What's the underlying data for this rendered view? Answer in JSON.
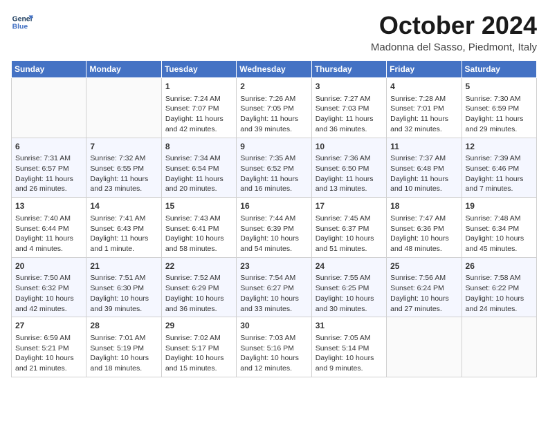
{
  "header": {
    "logo_line1": "General",
    "logo_line2": "Blue",
    "month_year": "October 2024",
    "location": "Madonna del Sasso, Piedmont, Italy"
  },
  "weekdays": [
    "Sunday",
    "Monday",
    "Tuesday",
    "Wednesday",
    "Thursday",
    "Friday",
    "Saturday"
  ],
  "weeks": [
    [
      {
        "day": "",
        "sunrise": "",
        "sunset": "",
        "daylight": ""
      },
      {
        "day": "",
        "sunrise": "",
        "sunset": "",
        "daylight": ""
      },
      {
        "day": "1",
        "sunrise": "Sunrise: 7:24 AM",
        "sunset": "Sunset: 7:07 PM",
        "daylight": "Daylight: 11 hours and 42 minutes."
      },
      {
        "day": "2",
        "sunrise": "Sunrise: 7:26 AM",
        "sunset": "Sunset: 7:05 PM",
        "daylight": "Daylight: 11 hours and 39 minutes."
      },
      {
        "day": "3",
        "sunrise": "Sunrise: 7:27 AM",
        "sunset": "Sunset: 7:03 PM",
        "daylight": "Daylight: 11 hours and 36 minutes."
      },
      {
        "day": "4",
        "sunrise": "Sunrise: 7:28 AM",
        "sunset": "Sunset: 7:01 PM",
        "daylight": "Daylight: 11 hours and 32 minutes."
      },
      {
        "day": "5",
        "sunrise": "Sunrise: 7:30 AM",
        "sunset": "Sunset: 6:59 PM",
        "daylight": "Daylight: 11 hours and 29 minutes."
      }
    ],
    [
      {
        "day": "6",
        "sunrise": "Sunrise: 7:31 AM",
        "sunset": "Sunset: 6:57 PM",
        "daylight": "Daylight: 11 hours and 26 minutes."
      },
      {
        "day": "7",
        "sunrise": "Sunrise: 7:32 AM",
        "sunset": "Sunset: 6:55 PM",
        "daylight": "Daylight: 11 hours and 23 minutes."
      },
      {
        "day": "8",
        "sunrise": "Sunrise: 7:34 AM",
        "sunset": "Sunset: 6:54 PM",
        "daylight": "Daylight: 11 hours and 20 minutes."
      },
      {
        "day": "9",
        "sunrise": "Sunrise: 7:35 AM",
        "sunset": "Sunset: 6:52 PM",
        "daylight": "Daylight: 11 hours and 16 minutes."
      },
      {
        "day": "10",
        "sunrise": "Sunrise: 7:36 AM",
        "sunset": "Sunset: 6:50 PM",
        "daylight": "Daylight: 11 hours and 13 minutes."
      },
      {
        "day": "11",
        "sunrise": "Sunrise: 7:37 AM",
        "sunset": "Sunset: 6:48 PM",
        "daylight": "Daylight: 11 hours and 10 minutes."
      },
      {
        "day": "12",
        "sunrise": "Sunrise: 7:39 AM",
        "sunset": "Sunset: 6:46 PM",
        "daylight": "Daylight: 11 hours and 7 minutes."
      }
    ],
    [
      {
        "day": "13",
        "sunrise": "Sunrise: 7:40 AM",
        "sunset": "Sunset: 6:44 PM",
        "daylight": "Daylight: 11 hours and 4 minutes."
      },
      {
        "day": "14",
        "sunrise": "Sunrise: 7:41 AM",
        "sunset": "Sunset: 6:43 PM",
        "daylight": "Daylight: 11 hours and 1 minute."
      },
      {
        "day": "15",
        "sunrise": "Sunrise: 7:43 AM",
        "sunset": "Sunset: 6:41 PM",
        "daylight": "Daylight: 10 hours and 58 minutes."
      },
      {
        "day": "16",
        "sunrise": "Sunrise: 7:44 AM",
        "sunset": "Sunset: 6:39 PM",
        "daylight": "Daylight: 10 hours and 54 minutes."
      },
      {
        "day": "17",
        "sunrise": "Sunrise: 7:45 AM",
        "sunset": "Sunset: 6:37 PM",
        "daylight": "Daylight: 10 hours and 51 minutes."
      },
      {
        "day": "18",
        "sunrise": "Sunrise: 7:47 AM",
        "sunset": "Sunset: 6:36 PM",
        "daylight": "Daylight: 10 hours and 48 minutes."
      },
      {
        "day": "19",
        "sunrise": "Sunrise: 7:48 AM",
        "sunset": "Sunset: 6:34 PM",
        "daylight": "Daylight: 10 hours and 45 minutes."
      }
    ],
    [
      {
        "day": "20",
        "sunrise": "Sunrise: 7:50 AM",
        "sunset": "Sunset: 6:32 PM",
        "daylight": "Daylight: 10 hours and 42 minutes."
      },
      {
        "day": "21",
        "sunrise": "Sunrise: 7:51 AM",
        "sunset": "Sunset: 6:30 PM",
        "daylight": "Daylight: 10 hours and 39 minutes."
      },
      {
        "day": "22",
        "sunrise": "Sunrise: 7:52 AM",
        "sunset": "Sunset: 6:29 PM",
        "daylight": "Daylight: 10 hours and 36 minutes."
      },
      {
        "day": "23",
        "sunrise": "Sunrise: 7:54 AM",
        "sunset": "Sunset: 6:27 PM",
        "daylight": "Daylight: 10 hours and 33 minutes."
      },
      {
        "day": "24",
        "sunrise": "Sunrise: 7:55 AM",
        "sunset": "Sunset: 6:25 PM",
        "daylight": "Daylight: 10 hours and 30 minutes."
      },
      {
        "day": "25",
        "sunrise": "Sunrise: 7:56 AM",
        "sunset": "Sunset: 6:24 PM",
        "daylight": "Daylight: 10 hours and 27 minutes."
      },
      {
        "day": "26",
        "sunrise": "Sunrise: 7:58 AM",
        "sunset": "Sunset: 6:22 PM",
        "daylight": "Daylight: 10 hours and 24 minutes."
      }
    ],
    [
      {
        "day": "27",
        "sunrise": "Sunrise: 6:59 AM",
        "sunset": "Sunset: 5:21 PM",
        "daylight": "Daylight: 10 hours and 21 minutes."
      },
      {
        "day": "28",
        "sunrise": "Sunrise: 7:01 AM",
        "sunset": "Sunset: 5:19 PM",
        "daylight": "Daylight: 10 hours and 18 minutes."
      },
      {
        "day": "29",
        "sunrise": "Sunrise: 7:02 AM",
        "sunset": "Sunset: 5:17 PM",
        "daylight": "Daylight: 10 hours and 15 minutes."
      },
      {
        "day": "30",
        "sunrise": "Sunrise: 7:03 AM",
        "sunset": "Sunset: 5:16 PM",
        "daylight": "Daylight: 10 hours and 12 minutes."
      },
      {
        "day": "31",
        "sunrise": "Sunrise: 7:05 AM",
        "sunset": "Sunset: 5:14 PM",
        "daylight": "Daylight: 10 hours and 9 minutes."
      },
      {
        "day": "",
        "sunrise": "",
        "sunset": "",
        "daylight": ""
      },
      {
        "day": "",
        "sunrise": "",
        "sunset": "",
        "daylight": ""
      }
    ]
  ]
}
